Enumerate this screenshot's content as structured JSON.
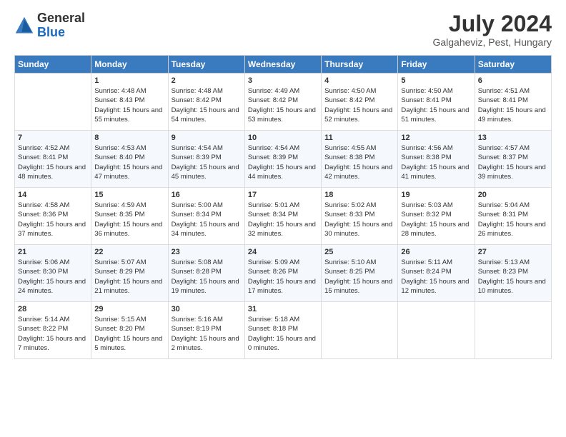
{
  "logo": {
    "general": "General",
    "blue": "Blue"
  },
  "header": {
    "month_year": "July 2024",
    "location": "Galgaheviz, Pest, Hungary"
  },
  "weekdays": [
    "Sunday",
    "Monday",
    "Tuesday",
    "Wednesday",
    "Thursday",
    "Friday",
    "Saturday"
  ],
  "weeks": [
    [
      {
        "day": "",
        "info": ""
      },
      {
        "day": "1",
        "info": "Sunrise: 4:48 AM\nSunset: 8:43 PM\nDaylight: 15 hours\nand 55 minutes."
      },
      {
        "day": "2",
        "info": "Sunrise: 4:48 AM\nSunset: 8:42 PM\nDaylight: 15 hours\nand 54 minutes."
      },
      {
        "day": "3",
        "info": "Sunrise: 4:49 AM\nSunset: 8:42 PM\nDaylight: 15 hours\nand 53 minutes."
      },
      {
        "day": "4",
        "info": "Sunrise: 4:50 AM\nSunset: 8:42 PM\nDaylight: 15 hours\nand 52 minutes."
      },
      {
        "day": "5",
        "info": "Sunrise: 4:50 AM\nSunset: 8:41 PM\nDaylight: 15 hours\nand 51 minutes."
      },
      {
        "day": "6",
        "info": "Sunrise: 4:51 AM\nSunset: 8:41 PM\nDaylight: 15 hours\nand 49 minutes."
      }
    ],
    [
      {
        "day": "7",
        "info": "Sunrise: 4:52 AM\nSunset: 8:41 PM\nDaylight: 15 hours\nand 48 minutes."
      },
      {
        "day": "8",
        "info": "Sunrise: 4:53 AM\nSunset: 8:40 PM\nDaylight: 15 hours\nand 47 minutes."
      },
      {
        "day": "9",
        "info": "Sunrise: 4:54 AM\nSunset: 8:39 PM\nDaylight: 15 hours\nand 45 minutes."
      },
      {
        "day": "10",
        "info": "Sunrise: 4:54 AM\nSunset: 8:39 PM\nDaylight: 15 hours\nand 44 minutes."
      },
      {
        "day": "11",
        "info": "Sunrise: 4:55 AM\nSunset: 8:38 PM\nDaylight: 15 hours\nand 42 minutes."
      },
      {
        "day": "12",
        "info": "Sunrise: 4:56 AM\nSunset: 8:38 PM\nDaylight: 15 hours\nand 41 minutes."
      },
      {
        "day": "13",
        "info": "Sunrise: 4:57 AM\nSunset: 8:37 PM\nDaylight: 15 hours\nand 39 minutes."
      }
    ],
    [
      {
        "day": "14",
        "info": "Sunrise: 4:58 AM\nSunset: 8:36 PM\nDaylight: 15 hours\nand 37 minutes."
      },
      {
        "day": "15",
        "info": "Sunrise: 4:59 AM\nSunset: 8:35 PM\nDaylight: 15 hours\nand 36 minutes."
      },
      {
        "day": "16",
        "info": "Sunrise: 5:00 AM\nSunset: 8:34 PM\nDaylight: 15 hours\nand 34 minutes."
      },
      {
        "day": "17",
        "info": "Sunrise: 5:01 AM\nSunset: 8:34 PM\nDaylight: 15 hours\nand 32 minutes."
      },
      {
        "day": "18",
        "info": "Sunrise: 5:02 AM\nSunset: 8:33 PM\nDaylight: 15 hours\nand 30 minutes."
      },
      {
        "day": "19",
        "info": "Sunrise: 5:03 AM\nSunset: 8:32 PM\nDaylight: 15 hours\nand 28 minutes."
      },
      {
        "day": "20",
        "info": "Sunrise: 5:04 AM\nSunset: 8:31 PM\nDaylight: 15 hours\nand 26 minutes."
      }
    ],
    [
      {
        "day": "21",
        "info": "Sunrise: 5:06 AM\nSunset: 8:30 PM\nDaylight: 15 hours\nand 24 minutes."
      },
      {
        "day": "22",
        "info": "Sunrise: 5:07 AM\nSunset: 8:29 PM\nDaylight: 15 hours\nand 21 minutes."
      },
      {
        "day": "23",
        "info": "Sunrise: 5:08 AM\nSunset: 8:28 PM\nDaylight: 15 hours\nand 19 minutes."
      },
      {
        "day": "24",
        "info": "Sunrise: 5:09 AM\nSunset: 8:26 PM\nDaylight: 15 hours\nand 17 minutes."
      },
      {
        "day": "25",
        "info": "Sunrise: 5:10 AM\nSunset: 8:25 PM\nDaylight: 15 hours\nand 15 minutes."
      },
      {
        "day": "26",
        "info": "Sunrise: 5:11 AM\nSunset: 8:24 PM\nDaylight: 15 hours\nand 12 minutes."
      },
      {
        "day": "27",
        "info": "Sunrise: 5:13 AM\nSunset: 8:23 PM\nDaylight: 15 hours\nand 10 minutes."
      }
    ],
    [
      {
        "day": "28",
        "info": "Sunrise: 5:14 AM\nSunset: 8:22 PM\nDaylight: 15 hours\nand 7 minutes."
      },
      {
        "day": "29",
        "info": "Sunrise: 5:15 AM\nSunset: 8:20 PM\nDaylight: 15 hours\nand 5 minutes."
      },
      {
        "day": "30",
        "info": "Sunrise: 5:16 AM\nSunset: 8:19 PM\nDaylight: 15 hours\nand 2 minutes."
      },
      {
        "day": "31",
        "info": "Sunrise: 5:18 AM\nSunset: 8:18 PM\nDaylight: 15 hours\nand 0 minutes."
      },
      {
        "day": "",
        "info": ""
      },
      {
        "day": "",
        "info": ""
      },
      {
        "day": "",
        "info": ""
      }
    ]
  ]
}
